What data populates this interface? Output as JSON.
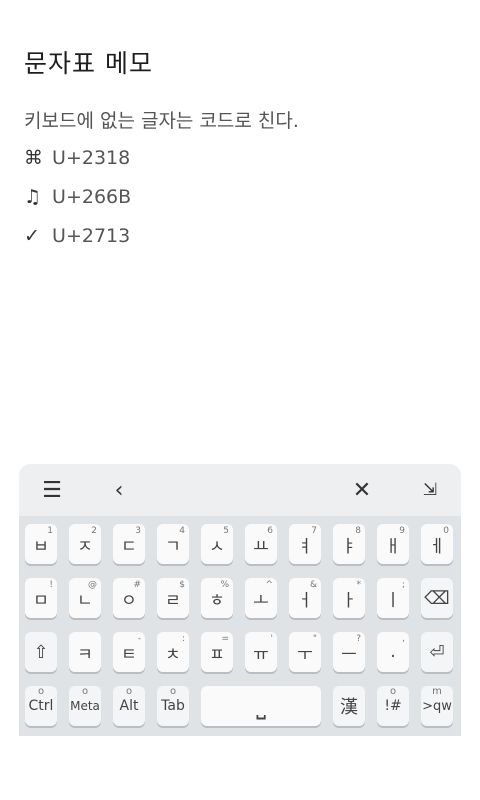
{
  "note": {
    "title": "문자표 메모",
    "body": "키보드에 없는 글자는 코드로 친다.",
    "lines": [
      {
        "glyph": "⌘",
        "code": "U+2318"
      },
      {
        "glyph": "♫",
        "code": "U+266B"
      },
      {
        "glyph": "✓",
        "code": "U+2713"
      }
    ]
  },
  "keyboard": {
    "toolbar": {
      "menu_icon": "☰",
      "back_icon": "‹",
      "close_icon": "✕",
      "hide_icon": "⇲"
    },
    "row1": [
      {
        "main": "ㅂ",
        "sub": "1"
      },
      {
        "main": "ㅈ",
        "sub": "2"
      },
      {
        "main": "ㄷ",
        "sub": "3"
      },
      {
        "main": "ㄱ",
        "sub": "4"
      },
      {
        "main": "ㅅ",
        "sub": "5"
      },
      {
        "main": "ㅛ",
        "sub": "6"
      },
      {
        "main": "ㅕ",
        "sub": "7"
      },
      {
        "main": "ㅑ",
        "sub": "8"
      },
      {
        "main": "ㅐ",
        "sub": "9"
      },
      {
        "main": "ㅔ",
        "sub": "0"
      }
    ],
    "row2": [
      {
        "main": "ㅁ",
        "sub": "!"
      },
      {
        "main": "ㄴ",
        "sub": "@"
      },
      {
        "main": "ㅇ",
        "sub": "#"
      },
      {
        "main": "ㄹ",
        "sub": "$"
      },
      {
        "main": "ㅎ",
        "sub": "%"
      },
      {
        "main": "ㅗ",
        "sub": "^"
      },
      {
        "main": "ㅓ",
        "sub": "&"
      },
      {
        "main": "ㅏ",
        "sub": "*"
      },
      {
        "main": "ㅣ",
        "sub": ";"
      },
      {
        "main": "⌫",
        "sub": ""
      }
    ],
    "row3": [
      {
        "main": "⇧",
        "sub": ""
      },
      {
        "main": "ㅋ",
        "sub": ""
      },
      {
        "main": "ㅌ",
        "sub": "-"
      },
      {
        "main": "ㅊ",
        "sub": ":"
      },
      {
        "main": "ㅍ",
        "sub": "="
      },
      {
        "main": "ㅠ",
        "sub": "'"
      },
      {
        "main": "ㅜ",
        "sub": "\""
      },
      {
        "main": "ㅡ",
        "sub": "?"
      },
      {
        "main": ".",
        "sub": ","
      },
      {
        "main": "⏎",
        "sub": ""
      }
    ],
    "row4": {
      "ctrl": {
        "main": "Ctrl",
        "top": "o"
      },
      "meta": {
        "main": "Meta",
        "top": "o"
      },
      "alt": {
        "main": "Alt",
        "top": "o"
      },
      "tab": {
        "main": "Tab",
        "top": "o"
      },
      "space": "⎵",
      "hanja": "漢",
      "symbols": {
        "main": "!#",
        "top": "o"
      },
      "lang": {
        "main": ">qw",
        "top": "m"
      }
    }
  }
}
